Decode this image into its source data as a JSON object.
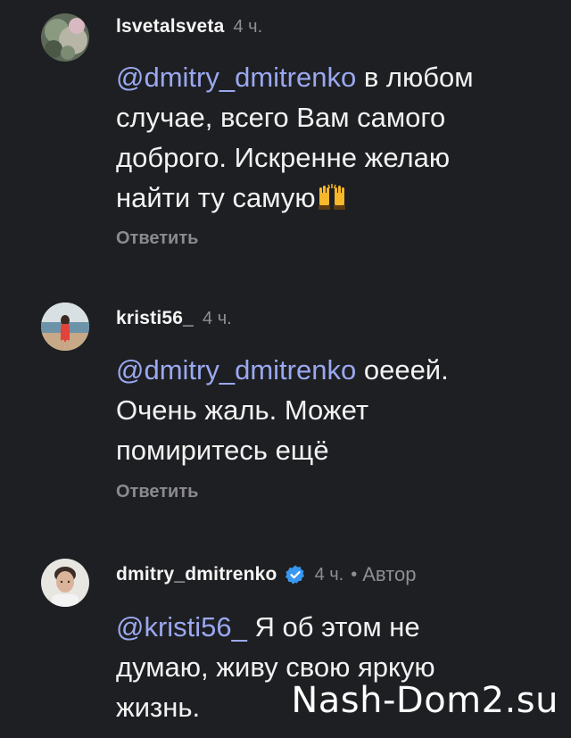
{
  "comments": [
    {
      "username": "lsvetalsveta",
      "time": "4 ч.",
      "mention": "@dmitry_dmitrenko",
      "lines": [
        "в любом",
        "случае, всего Вам самого",
        "доброго. Искренне желаю",
        "найти ту самую"
      ],
      "emoji_name": "raising-hands-icon",
      "reply_label": "Ответить"
    },
    {
      "username": "kristi56_",
      "time": "4 ч.",
      "mention": "@dmitry_dmitrenko",
      "lines": [
        "оееей.",
        "Очень жаль. Может",
        "помиритесь ещё"
      ],
      "reply_label": "Ответить"
    },
    {
      "username": "dmitry_dmitrenko",
      "time": "4 ч.",
      "separator": "•",
      "author_label": "Автор",
      "verified_icon": "verified-badge-icon",
      "mention": "@kristi56_",
      "lines": [
        "Я об этом не",
        "думаю, живу свою яркую",
        "жизнь."
      ]
    }
  ],
  "watermark": "Nash-Dom2.su",
  "colors": {
    "background": "#1e1f22",
    "mention": "#9aa8f0",
    "muted": "#8e8e93",
    "verified": "#3897f0"
  }
}
